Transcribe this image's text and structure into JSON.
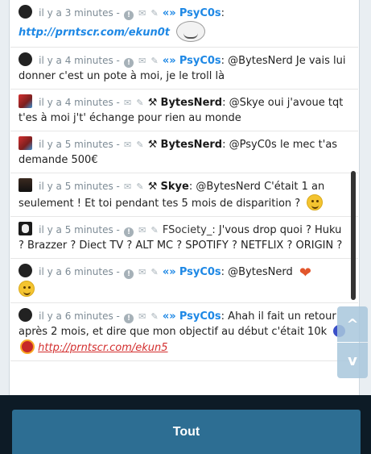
{
  "messages": [
    {
      "time": "il y a 3 minutes -",
      "author": "PsyC0s",
      "author_type": "psy",
      "sep": ":",
      "text": "",
      "link": "http://prntscr.com/ekun0t",
      "extra": "troll"
    },
    {
      "time": "il y a 4 minutes -",
      "author": "PsyC0s",
      "author_type": "psy",
      "sep": ":",
      "text": " @BytesNerd Je vais lui donner c'est un pote à moi, je le troll là"
    },
    {
      "time": "il y a 4 minutes -",
      "author": "BytesNerd",
      "author_type": "bytes",
      "sep": ":",
      "text": " @Skye oui j'avoue tqt t'es à moi j't' échange pour rien au monde"
    },
    {
      "time": "il y a 5 minutes -",
      "author": "BytesNerd",
      "author_type": "bytes",
      "sep": ":",
      "text": " @PsyC0s le mec t'as demande 500€"
    },
    {
      "time": "il y a 5 minutes -",
      "author": "Skye",
      "author_type": "skye",
      "sep": ":",
      "text": " @BytesNerd C'était 1 an seulement ! Et toi pendant tes 5 mois de disparition ?"
    },
    {
      "time": "il y a 5 minutes -",
      "author": "FSociety_",
      "author_type": "fs",
      "sep": ":",
      "text": " J'vous drop quoi ? Huku ? Brazzer ? Diect TV ? ALT MC ? SPOTIFY ? NETFLIX ? ORIGIN ?"
    },
    {
      "time": "il y a 6 minutes -",
      "author": "PsyC0s",
      "author_type": "psy",
      "sep": ":",
      "text": " @BytesNerd"
    },
    {
      "time": "il y a 6 minutes -",
      "author": "PsyC0s",
      "author_type": "psy",
      "sep": ":",
      "text": " Ahah il fait un retour après 2 mois, et dire que mon objectif au début c'était 10k",
      "link": "http://prntscr.com/ekun5"
    }
  ],
  "footer": {
    "tout_label": "Tout"
  },
  "icons": {
    "scroll_up": "^",
    "scroll_down": "v",
    "warn": "!",
    "mail": "✉",
    "tag": "✎",
    "gem": "«»",
    "hammer": "⚒",
    "heart": "❤"
  }
}
